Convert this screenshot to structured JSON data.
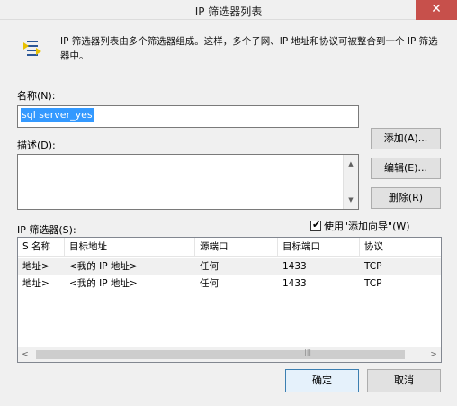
{
  "window": {
    "title": "IP 筛选器列表",
    "close_glyph": "✕"
  },
  "intro": {
    "text": "IP 筛选器列表由多个筛选器组成。这样，多个子网、IP 地址和协议可被整合到一个 IP 筛选器中。",
    "icon": "filter-list-icon"
  },
  "name": {
    "label": "名称(N):",
    "value": "sql server_yes"
  },
  "description": {
    "label": "描述(D):",
    "value": ""
  },
  "buttons": {
    "add": "添加(A)...",
    "edit": "编辑(E)...",
    "remove": "删除(R)",
    "ok": "确定",
    "cancel": "取消"
  },
  "filters": {
    "label": "IP 筛选器(S):",
    "wizard_checkbox": {
      "label": "使用\"添加向导\"(W)",
      "checked": true
    },
    "columns": [
      "S 名称",
      "目标地址",
      "源端口",
      "目标端口",
      "协议"
    ],
    "rows": [
      [
        "地址>",
        "<我的 IP 地址>",
        "任何",
        "1433",
        "TCP"
      ],
      [
        "地址>",
        "<我的 IP 地址>",
        "任何",
        "1433",
        "TCP"
      ]
    ]
  },
  "scrollbar": {
    "left_arrow": "<",
    "right_arrow": ">",
    "up_arrow": "▲",
    "down_arrow": "▼",
    "grip": "|||"
  },
  "colors": {
    "close_button": "#c7504b",
    "selection": "#3399ff",
    "window_bg": "#f0f0f0"
  }
}
